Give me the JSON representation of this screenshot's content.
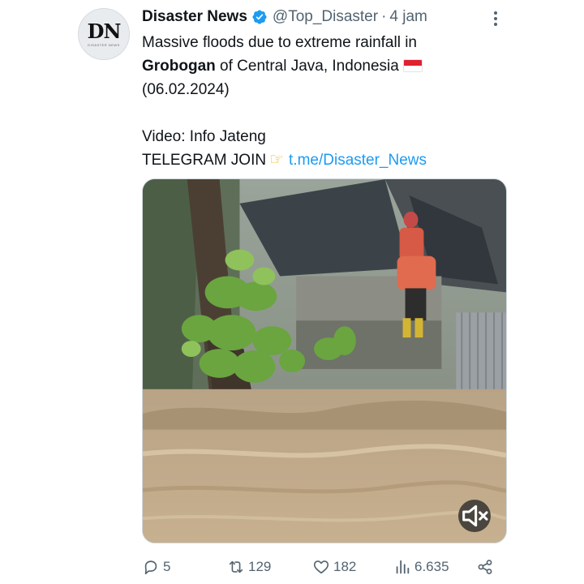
{
  "tweet": {
    "avatar_text": "DN",
    "avatar_sub": "DISASTER NEWS",
    "author_name": "Disaster News",
    "handle": "@Top_Disaster",
    "separator": "·",
    "time": "4 jam",
    "text": {
      "line1": "Massive floods due to extreme rainfall in",
      "line2_bold": "Grobogan",
      "line2_rest": " of Central Java, Indonesia",
      "line3": "(06.02.2024)",
      "line5": "Video: Info Jateng",
      "line6_prefix": "TELEGRAM JOIN",
      "line6_link": "t.me/Disaster_News"
    }
  },
  "actions": {
    "replies": "5",
    "retweets": "129",
    "likes": "182",
    "views": "6.635"
  },
  "icons": {
    "verified": "verified-badge-icon",
    "flag": "indonesia-flag-icon",
    "pointing": "pointing-hand-icon",
    "mute": "muted-speaker-icon",
    "reply": "reply-icon",
    "retweet": "retweet-icon",
    "like": "heart-icon",
    "views": "views-chart-icon",
    "share": "share-icon",
    "more": "more-vertical-icon"
  },
  "colors": {
    "accent": "#1d9bf0",
    "muted_text": "#536471",
    "text": "#0f1419"
  }
}
